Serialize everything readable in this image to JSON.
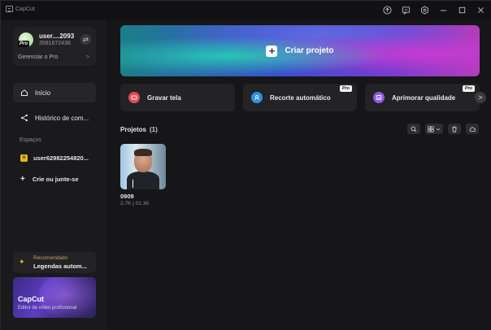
{
  "titlebar": {
    "app_name": "CapCut",
    "icons": [
      "upload-icon",
      "feedback-icon",
      "settings-icon",
      "minimize-icon",
      "maximize-icon",
      "close-icon"
    ]
  },
  "account": {
    "username": "user....2093",
    "user_id": "3581672436",
    "pro_tag": "Pro",
    "manage_label": "Gerenciar o Pro",
    "manage_arrow": ">"
  },
  "sidebar": {
    "nav": [
      {
        "label": "Início",
        "icon": "home-icon"
      },
      {
        "label": "Histórico de com...",
        "icon": "share-icon"
      }
    ],
    "spaces_label": "Espaços",
    "space": {
      "badge": "u",
      "label": "user62982254820..."
    },
    "create_label": "Crie ou junte-se",
    "create_icon": "+",
    "recommend": {
      "label": "Recomendado",
      "title": "Legendas autom..."
    },
    "promo": {
      "title": "CapCut",
      "subtitle": "Editor de vídeo profissional"
    }
  },
  "main": {
    "hero_label": "Criar projeto",
    "hero_icon": "+",
    "quick_actions": [
      {
        "label": "Gravar tela",
        "icon": "record-icon",
        "color": "#e24b5a",
        "pro": false
      },
      {
        "label": "Recorte automático",
        "icon": "cutout-icon",
        "color": "#2f8fe6",
        "pro": true,
        "pro_label": "Pro"
      },
      {
        "label": "Aprimorar qualidade",
        "icon": "enhance-icon",
        "color": "#8a5ae8",
        "pro": true,
        "pro_label": "Pro"
      }
    ],
    "next_arrow": ">",
    "projects": {
      "title": "Projetos",
      "count": "(1)",
      "items": [
        {
          "name": "0909",
          "meta": "2.7K | 01:36"
        }
      ]
    }
  }
}
